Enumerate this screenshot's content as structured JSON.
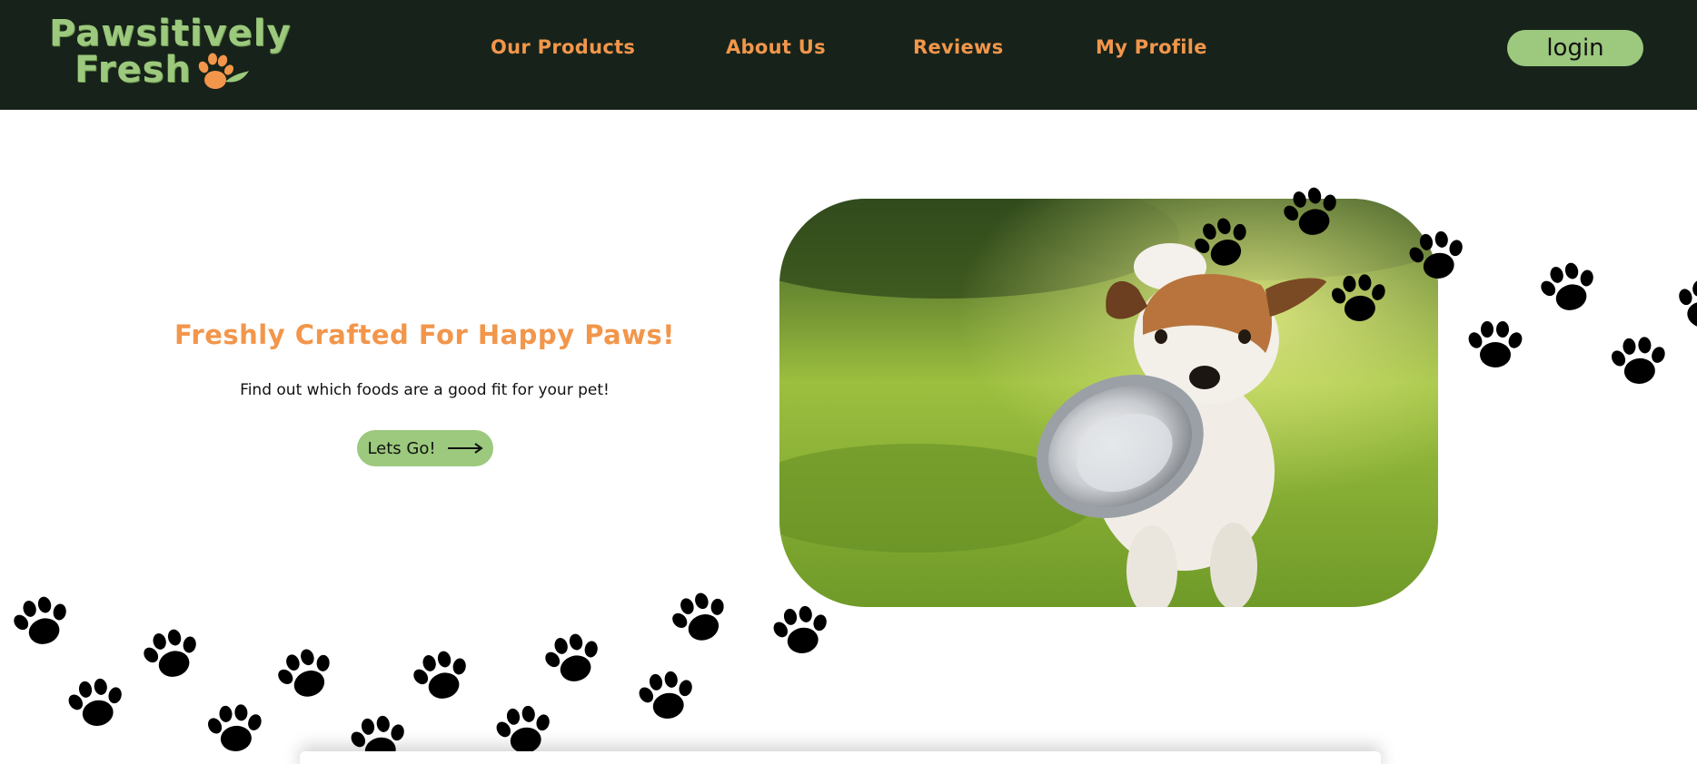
{
  "brand": {
    "name_line_1": "Pawsitively",
    "name_line_2": "Fresh",
    "logo_icon": "paw-leaf-icon",
    "colors": {
      "header_bg": "#17231a",
      "green": "#9cc97d",
      "orange": "#f2964b"
    }
  },
  "nav": {
    "items": [
      {
        "label": "Our Products"
      },
      {
        "label": "About Us"
      },
      {
        "label": "Reviews"
      },
      {
        "label": "My Profile"
      }
    ],
    "login_label": "login"
  },
  "hero": {
    "title": "Freshly Crafted For Happy Paws!",
    "subtitle": "Find out which foods are a good fit for your pet!",
    "cta_label": "Lets Go!",
    "cta_icon": "long-arrow-right-icon",
    "image_subject": "dog-with-bowl-photo"
  },
  "decoration": {
    "paw_icon": "paw-print-icon",
    "paw_color": "#000000"
  }
}
